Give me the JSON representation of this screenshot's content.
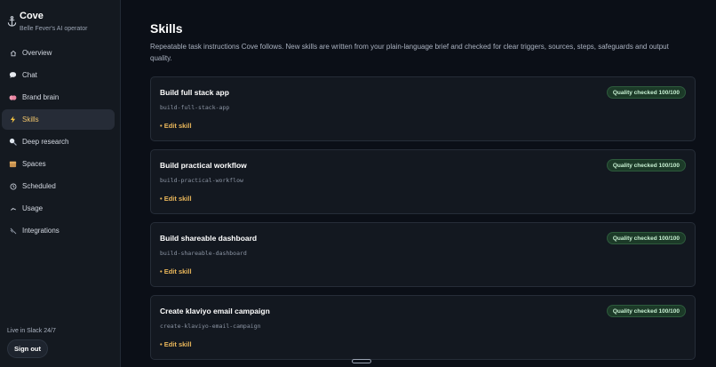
{
  "app": {
    "name": "Cove",
    "subtitle": "Belle Fever's AI operator"
  },
  "sidebar": {
    "items": [
      {
        "label": "Overview",
        "icon": "home-icon",
        "active": false
      },
      {
        "label": "Chat",
        "icon": "chat-bubble-icon",
        "active": false
      },
      {
        "label": "Brand brain",
        "icon": "brain-icon",
        "active": false
      },
      {
        "label": "Skills",
        "icon": "lightning-icon",
        "active": true
      },
      {
        "label": "Deep research",
        "icon": "magnifier-icon",
        "active": false
      },
      {
        "label": "Spaces",
        "icon": "box-icon",
        "active": false
      },
      {
        "label": "Scheduled",
        "icon": "clock-icon",
        "active": false
      },
      {
        "label": "Usage",
        "icon": "chart-icon",
        "active": false
      },
      {
        "label": "Integrations",
        "icon": "link-icon",
        "active": false
      }
    ],
    "status": "Live in Slack 24/7",
    "signout_label": "Sign out"
  },
  "main": {
    "title": "Skills",
    "description": "Repeatable task instructions Cove follows. New skills are written from your plain-language brief and checked for clear triggers, sources, steps, safeguards and output quality.",
    "skills": [
      {
        "title": "Build full stack app",
        "slug": "build-full-stack-app",
        "badge": "Quality checked 100/100",
        "edit_label": "• Edit skill"
      },
      {
        "title": "Build practical workflow",
        "slug": "build-practical-workflow",
        "badge": "Quality checked 100/100",
        "edit_label": "• Edit skill"
      },
      {
        "title": "Build shareable dashboard",
        "slug": "build-shareable-dashboard",
        "badge": "Quality checked 100/100",
        "edit_label": "• Edit skill"
      },
      {
        "title": "Create klaviyo email campaign",
        "slug": "create-klaviyo-email-campaign",
        "badge": "Quality checked 100/100",
        "edit_label": "• Edit skill"
      }
    ]
  },
  "colors": {
    "accent": "#f0c46b",
    "badge_bg": "#1c3a28",
    "badge_text": "#c7f0d2",
    "background": "#0b0f17",
    "sidebar": "#141920"
  }
}
